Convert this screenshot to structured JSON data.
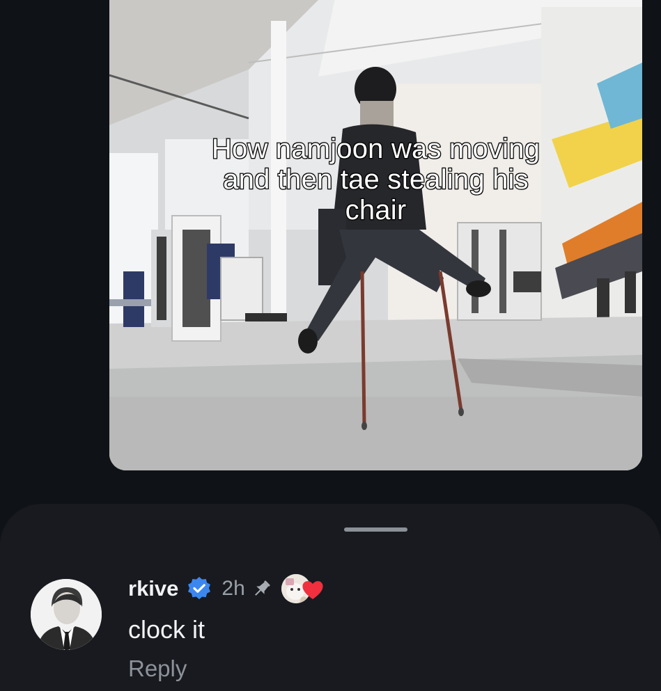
{
  "video": {
    "caption": "How namjoon was moving\nand then tae stealing his\nchair"
  },
  "comment": {
    "username": "rkive",
    "timestamp": "2h",
    "text": "clock it",
    "reply_label": "Reply",
    "icons": {
      "verified": "verified-badge-icon",
      "pin": "pin-icon",
      "heart": "heart-icon"
    }
  },
  "colors": {
    "background": "#0f1217",
    "sheet": "#181a1f",
    "verified": "#3b87f0",
    "heart": "#f0303e",
    "reply": "#8d929a"
  }
}
